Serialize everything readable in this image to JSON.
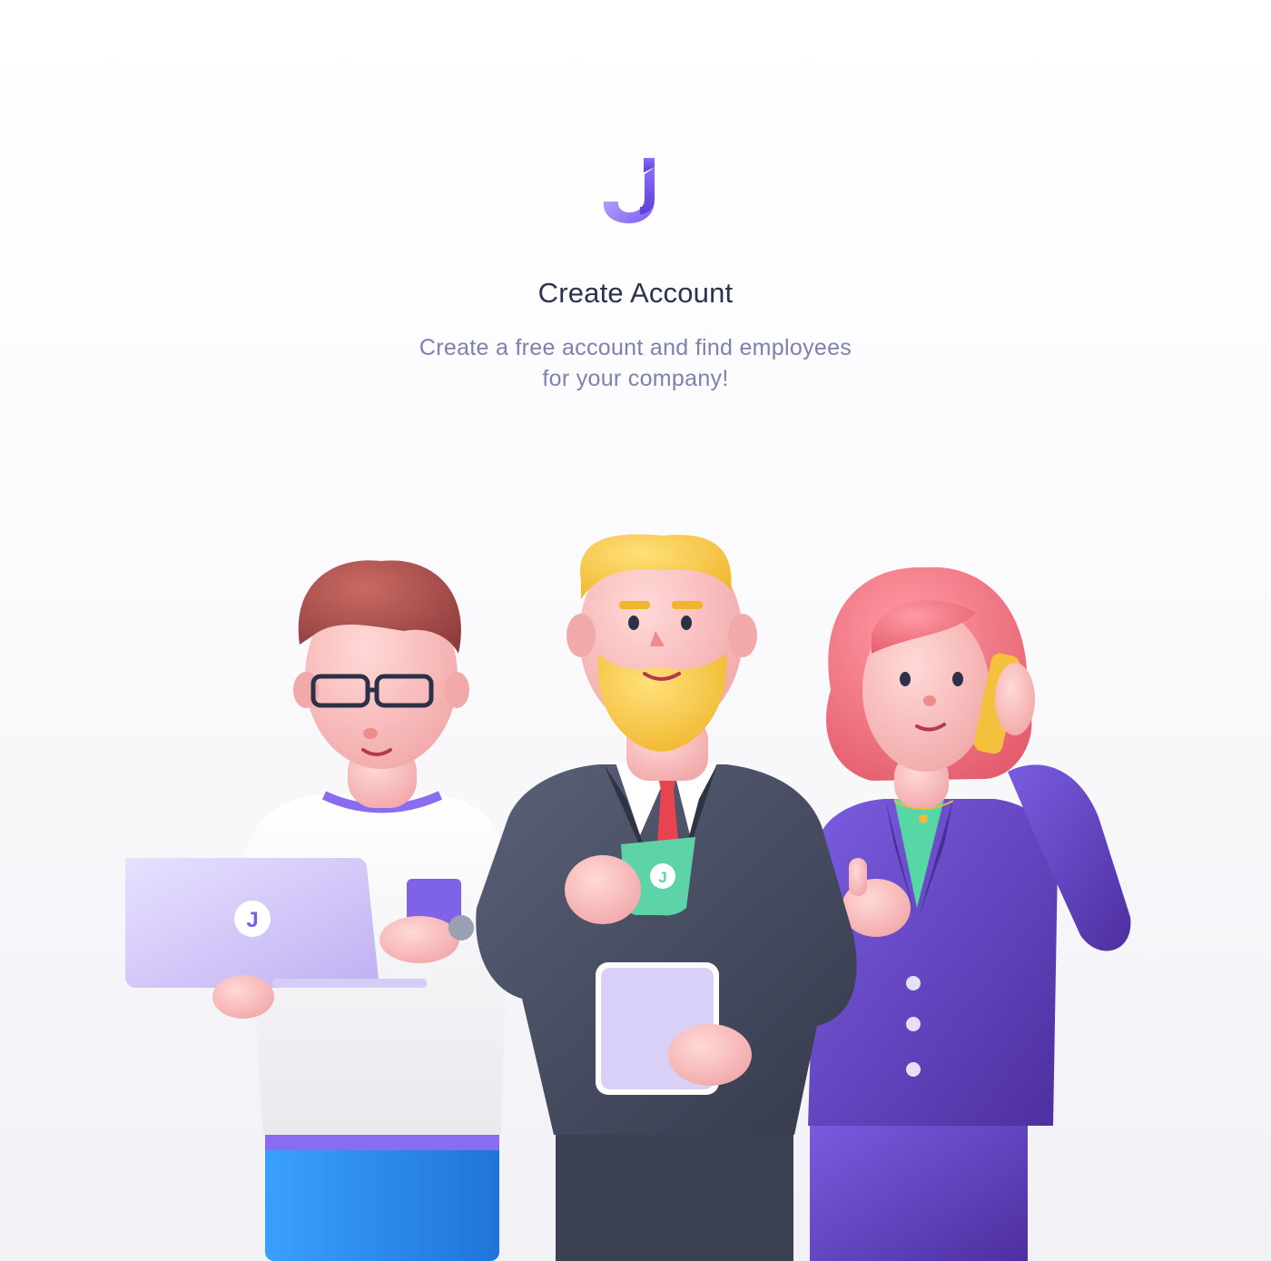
{
  "brand": {
    "logo_icon": "j-letter-logo-icon",
    "accent": "#7c5cf0"
  },
  "heading": {
    "title": "Create Account",
    "subtitle_line1": "Create a free account and find employees",
    "subtitle_line2": "for your company!"
  },
  "illustration": {
    "figures": [
      "developer-with-laptop",
      "businessman-with-mug",
      "businesswoman-on-phone"
    ],
    "colors": {
      "title": "#2a3350",
      "subtitle": "#7c82b0",
      "suit_dark": "#454b60",
      "suit_purple": "#5d3fae",
      "hair_blond": "#f5c440",
      "hair_red": "#ef6f7f",
      "hair_brown": "#a94d4d",
      "mug": "#5fd3a8",
      "jeans": "#2f8df0"
    }
  }
}
